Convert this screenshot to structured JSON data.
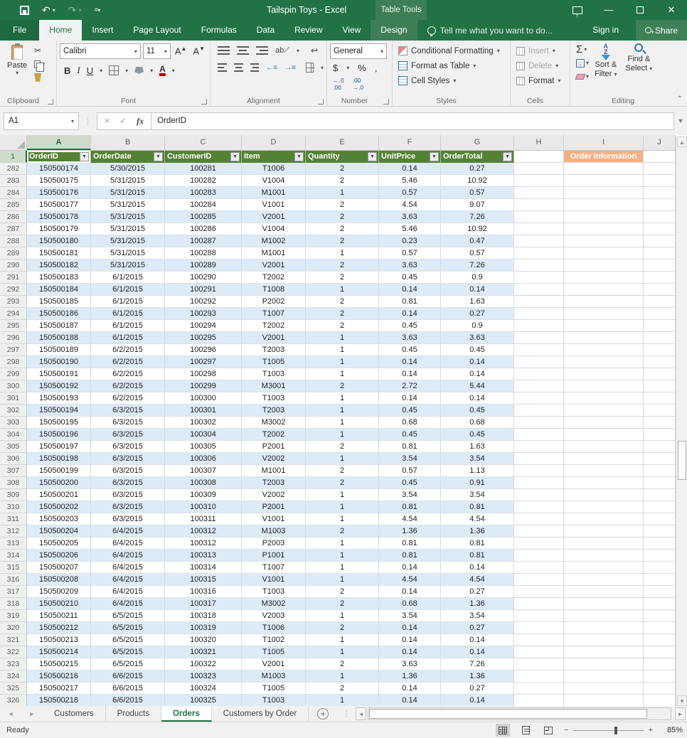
{
  "window": {
    "title": "Tailspin Toys - Excel",
    "context_group": "Table Tools"
  },
  "tabs": [
    {
      "label": "File"
    },
    {
      "label": "Home"
    },
    {
      "label": "Insert"
    },
    {
      "label": "Page Layout"
    },
    {
      "label": "Formulas"
    },
    {
      "label": "Data"
    },
    {
      "label": "Review"
    },
    {
      "label": "View"
    },
    {
      "label": "Design"
    }
  ],
  "tell_me": "Tell me what you want to do...",
  "account": {
    "sign_in": "Sign in",
    "share": "Share"
  },
  "ribbon": {
    "clipboard": {
      "label": "Clipboard",
      "paste": "Paste"
    },
    "font": {
      "label": "Font",
      "font_name": "Calibri",
      "font_size": "11"
    },
    "alignment": {
      "label": "Alignment"
    },
    "number": {
      "label": "Number",
      "format": "General",
      "dec_inc": ".00",
      "dec_dec": ".00"
    },
    "styles": {
      "label": "Styles",
      "items": [
        "Conditional Formatting",
        "Format as Table",
        "Cell Styles"
      ]
    },
    "cells": {
      "label": "Cells",
      "items": [
        "Insert",
        "Delete",
        "Format"
      ]
    },
    "editing": {
      "label": "Editing",
      "sort_filter_1": "Sort &",
      "sort_filter_2": "Filter",
      "find_select_1": "Find &",
      "find_select_2": "Select"
    }
  },
  "formula_bar": {
    "name_box": "A1",
    "value": "OrderID"
  },
  "grid": {
    "column_letters": [
      "A",
      "B",
      "C",
      "D",
      "E",
      "F",
      "G",
      "H",
      "I",
      "J"
    ],
    "selected_cell": "A1",
    "selected_column": "A",
    "header_row_number": "1",
    "table_headers": [
      "OrderID",
      "OrderDate",
      "CustomerID",
      "Item",
      "Quantity",
      "UnitPrice",
      "OrderTotal"
    ],
    "side_header": "Order Information",
    "rows": [
      [
        282,
        "150500174",
        "5/30/2015",
        "100281",
        "T1006",
        "2",
        "0.14",
        "0.27"
      ],
      [
        283,
        "150500175",
        "5/31/2015",
        "100282",
        "V1004",
        "2",
        "5.46",
        "10.92"
      ],
      [
        284,
        "150500176",
        "5/31/2015",
        "100283",
        "M1001",
        "1",
        "0.57",
        "0.57"
      ],
      [
        285,
        "150500177",
        "5/31/2015",
        "100284",
        "V1001",
        "2",
        "4.54",
        "9.07"
      ],
      [
        286,
        "150500178",
        "5/31/2015",
        "100285",
        "V2001",
        "2",
        "3.63",
        "7.26"
      ],
      [
        287,
        "150500179",
        "5/31/2015",
        "100286",
        "V1004",
        "2",
        "5.46",
        "10.92"
      ],
      [
        288,
        "150500180",
        "5/31/2015",
        "100287",
        "M1002",
        "2",
        "0.23",
        "0.47"
      ],
      [
        289,
        "150500181",
        "5/31/2015",
        "100288",
        "M1001",
        "1",
        "0.57",
        "0.57"
      ],
      [
        290,
        "150500182",
        "5/31/2015",
        "100289",
        "V2001",
        "2",
        "3.63",
        "7.26"
      ],
      [
        291,
        "150500183",
        "6/1/2015",
        "100290",
        "T2002",
        "2",
        "0.45",
        "0.9"
      ],
      [
        292,
        "150500184",
        "6/1/2015",
        "100291",
        "T1008",
        "1",
        "0.14",
        "0.14"
      ],
      [
        293,
        "150500185",
        "6/1/2015",
        "100292",
        "P2002",
        "2",
        "0.81",
        "1.63"
      ],
      [
        294,
        "150500186",
        "6/1/2015",
        "100293",
        "T1007",
        "2",
        "0.14",
        "0.27"
      ],
      [
        295,
        "150500187",
        "6/1/2015",
        "100294",
        "T2002",
        "2",
        "0.45",
        "0.9"
      ],
      [
        296,
        "150500188",
        "6/1/2015",
        "100295",
        "V2001",
        "1",
        "3.63",
        "3.63"
      ],
      [
        297,
        "150500189",
        "6/2/2015",
        "100296",
        "T2003",
        "1",
        "0.45",
        "0.45"
      ],
      [
        298,
        "150500190",
        "6/2/2015",
        "100297",
        "T1005",
        "1",
        "0.14",
        "0.14"
      ],
      [
        299,
        "150500191",
        "6/2/2015",
        "100298",
        "T1003",
        "1",
        "0.14",
        "0.14"
      ],
      [
        300,
        "150500192",
        "6/2/2015",
        "100299",
        "M3001",
        "2",
        "2.72",
        "5.44"
      ],
      [
        301,
        "150500193",
        "6/2/2015",
        "100300",
        "T1003",
        "1",
        "0.14",
        "0.14"
      ],
      [
        302,
        "150500194",
        "6/3/2015",
        "100301",
        "T2003",
        "1",
        "0.45",
        "0.45"
      ],
      [
        303,
        "150500195",
        "6/3/2015",
        "100302",
        "M3002",
        "1",
        "0.68",
        "0.68"
      ],
      [
        304,
        "150500196",
        "6/3/2015",
        "100304",
        "T2002",
        "1",
        "0.45",
        "0.45"
      ],
      [
        305,
        "150500197",
        "6/3/2015",
        "100305",
        "P2001",
        "2",
        "0.81",
        "1.63"
      ],
      [
        306,
        "150500198",
        "6/3/2015",
        "100306",
        "V2002",
        "1",
        "3.54",
        "3.54"
      ],
      [
        307,
        "150500199",
        "6/3/2015",
        "100307",
        "M1001",
        "2",
        "0.57",
        "1.13"
      ],
      [
        308,
        "150500200",
        "6/3/2015",
        "100308",
        "T2003",
        "2",
        "0.45",
        "0.91"
      ],
      [
        309,
        "150500201",
        "6/3/2015",
        "100309",
        "V2002",
        "1",
        "3.54",
        "3.54"
      ],
      [
        310,
        "150500202",
        "6/3/2015",
        "100310",
        "P2001",
        "1",
        "0.81",
        "0.81"
      ],
      [
        311,
        "150500203",
        "6/3/2015",
        "100311",
        "V1001",
        "1",
        "4.54",
        "4.54"
      ],
      [
        312,
        "150500204",
        "6/4/2015",
        "100312",
        "M1003",
        "2",
        "1.36",
        "1.36"
      ],
      [
        313,
        "150500205",
        "6/4/2015",
        "100312",
        "P2003",
        "1",
        "0.81",
        "0.81"
      ],
      [
        314,
        "150500206",
        "6/4/2015",
        "100313",
        "P1001",
        "1",
        "0.81",
        "0.81"
      ],
      [
        315,
        "150500207",
        "6/4/2015",
        "100314",
        "T1007",
        "1",
        "0.14",
        "0.14"
      ],
      [
        316,
        "150500208",
        "6/4/2015",
        "100315",
        "V1001",
        "1",
        "4.54",
        "4.54"
      ],
      [
        317,
        "150500209",
        "6/4/2015",
        "100316",
        "T1003",
        "2",
        "0.14",
        "0.27"
      ],
      [
        318,
        "150500210",
        "6/4/2015",
        "100317",
        "M3002",
        "2",
        "0.68",
        "1.36"
      ],
      [
        319,
        "150500211",
        "6/5/2015",
        "100318",
        "V2003",
        "1",
        "3.54",
        "3.54"
      ],
      [
        320,
        "150500212",
        "6/5/2015",
        "100319",
        "T1006",
        "2",
        "0.14",
        "0.27"
      ],
      [
        321,
        "150500213",
        "6/5/2015",
        "100320",
        "T1002",
        "1",
        "0.14",
        "0.14"
      ],
      [
        322,
        "150500214",
        "6/5/2015",
        "100321",
        "T1005",
        "1",
        "0.14",
        "0.14"
      ],
      [
        323,
        "150500215",
        "6/5/2015",
        "100322",
        "V2001",
        "2",
        "3.63",
        "7.26"
      ],
      [
        324,
        "150500216",
        "6/6/2015",
        "100323",
        "M1003",
        "1",
        "1.36",
        "1.36"
      ],
      [
        325,
        "150500217",
        "6/6/2015",
        "100324",
        "T1005",
        "2",
        "0.14",
        "0.27"
      ],
      [
        326,
        "150500218",
        "6/6/2015",
        "100325",
        "T1003",
        "1",
        "0.14",
        "0.14"
      ]
    ]
  },
  "sheet_tabs": {
    "tabs": [
      "Customers",
      "Products",
      "Orders",
      "Customers by Order"
    ],
    "active": "Orders"
  },
  "status_bar": {
    "status": "Ready",
    "zoom": "85%"
  },
  "colors": {
    "title_green": "#217346",
    "contextual_green": "#3E7E57",
    "table_header_green": "#548235",
    "band_blue": "#DDEBF7",
    "side_header_peach": "#F4B183",
    "font_color_red": "#C00000"
  },
  "icons": {
    "scissors": "✂",
    "dropdown": "▾",
    "autosum": "Σ",
    "check": "✓",
    "close-x": "×",
    "up-arrow": "▲",
    "down-arrow": "▼",
    "left-arrow": "◄",
    "right-arrow": "►",
    "plus": "+",
    "minus": "−",
    "ellipsis-v": "⋮",
    "chevron-up": "˄",
    "undo": "↶",
    "redo": "↷",
    "wrap-text": "↩",
    "dollar": "$",
    "percent": "%",
    "comma": ",",
    "orientation": "ab",
    "fx": "fx"
  }
}
